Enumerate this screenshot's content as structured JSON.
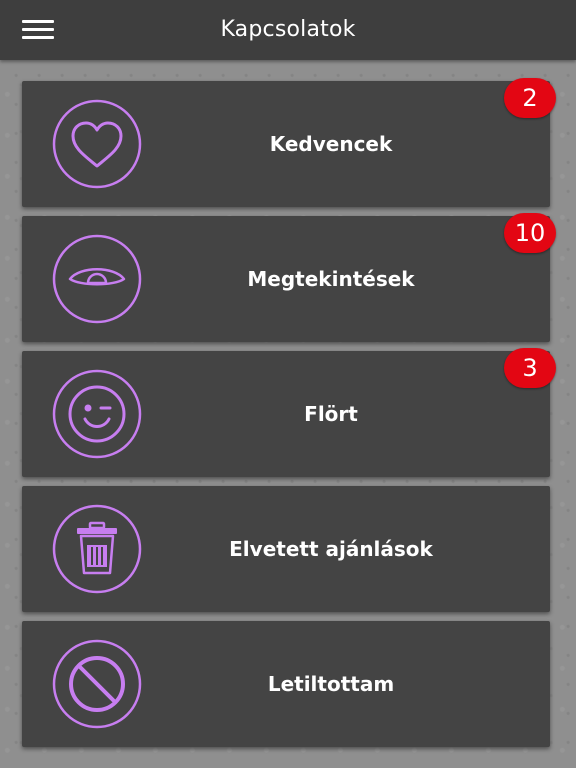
{
  "header": {
    "title": "Kapcsolatok",
    "menu_icon": "hamburger-menu-icon"
  },
  "colors": {
    "header_bg": "#3e3e3e",
    "card_bg": "#444444",
    "icon_accent": "#c77ef0",
    "badge_bg": "#e30613",
    "page_bg": "#8f8f8f"
  },
  "items": [
    {
      "label": "Kedvencek",
      "icon": "heart-icon",
      "badge": "2"
    },
    {
      "label": "Megtekintések",
      "icon": "eye-icon",
      "badge": "10"
    },
    {
      "label": "Flört",
      "icon": "wink-smiley-icon",
      "badge": "3"
    },
    {
      "label": "Elvetett ajánlások",
      "icon": "trash-icon"
    },
    {
      "label": "Letiltottam",
      "icon": "block-icon"
    }
  ]
}
